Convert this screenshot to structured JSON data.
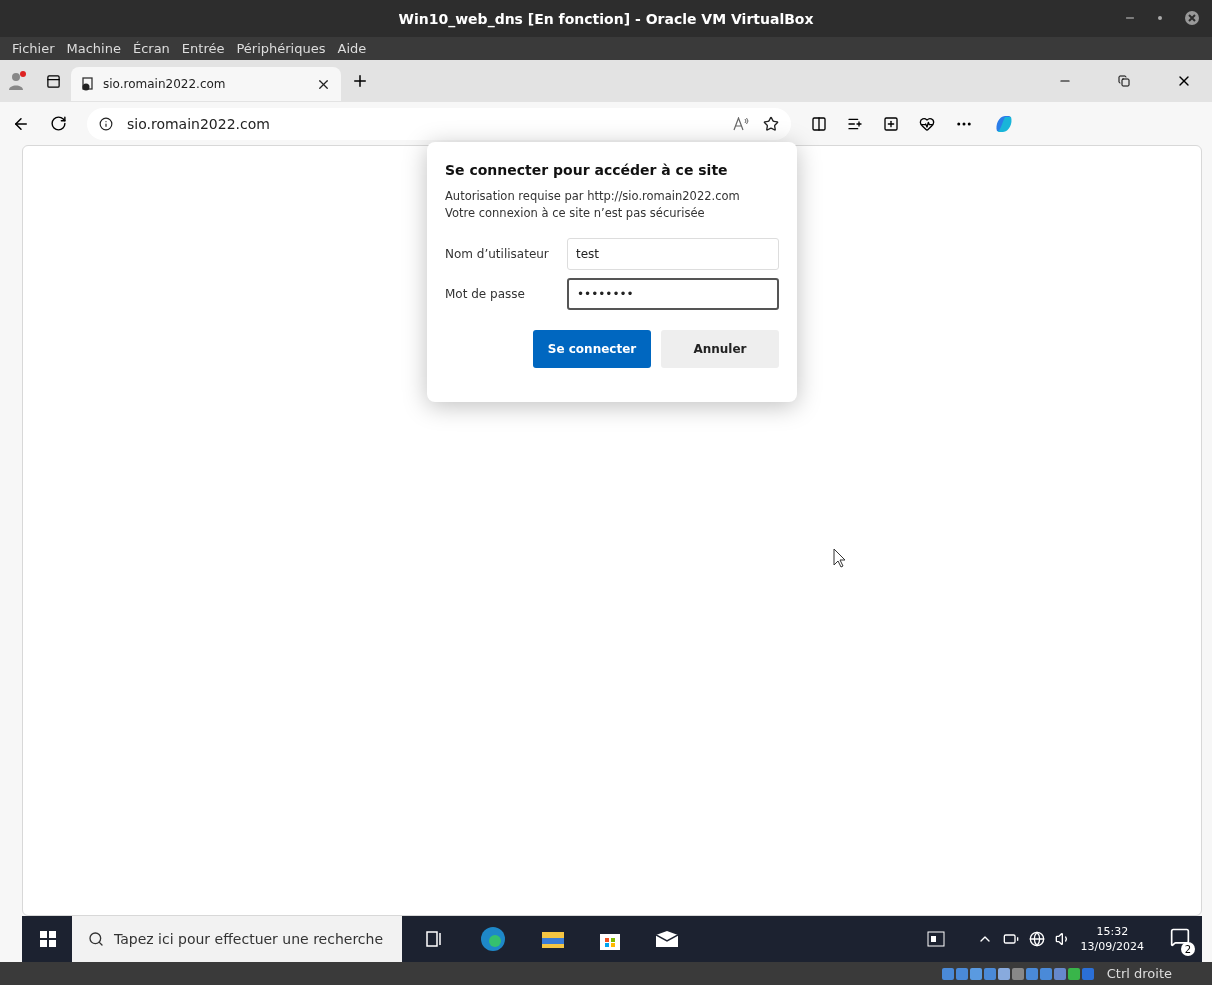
{
  "vm_window": {
    "title": "Win10_web_dns [En fonction] - Oracle VM VirtualBox",
    "menu": [
      "Fichier",
      "Machine",
      "Écran",
      "Entrée",
      "Périphériques",
      "Aide"
    ]
  },
  "browser": {
    "tabs": [
      {
        "title": "sio.romain2022.com",
        "selected": true
      }
    ],
    "address": "sio.romain2022.com"
  },
  "auth_dialog": {
    "title": "Se connecter pour accéder à ce site",
    "message_lines": [
      "Autorisation requise par http://sio.romain2022.com",
      "Votre connexion à ce site n’est pas sécurisée"
    ],
    "fields": [
      {
        "label": "Nom d’utilisateur",
        "value": "test",
        "focused": false
      },
      {
        "label": "Mot de passe",
        "value": "••••••••",
        "focused": true
      }
    ],
    "buttons": [
      {
        "label": "Se connecter",
        "primary": true
      },
      {
        "label": "Annuler",
        "primary": false
      }
    ]
  },
  "taskbar": {
    "search_placeholder": "Tapez ici pour effectuer une recherche",
    "time": "15:32",
    "date": "13/09/2024",
    "notification_count": "2"
  },
  "vm_status": {
    "host_key": "Ctrl droite"
  }
}
